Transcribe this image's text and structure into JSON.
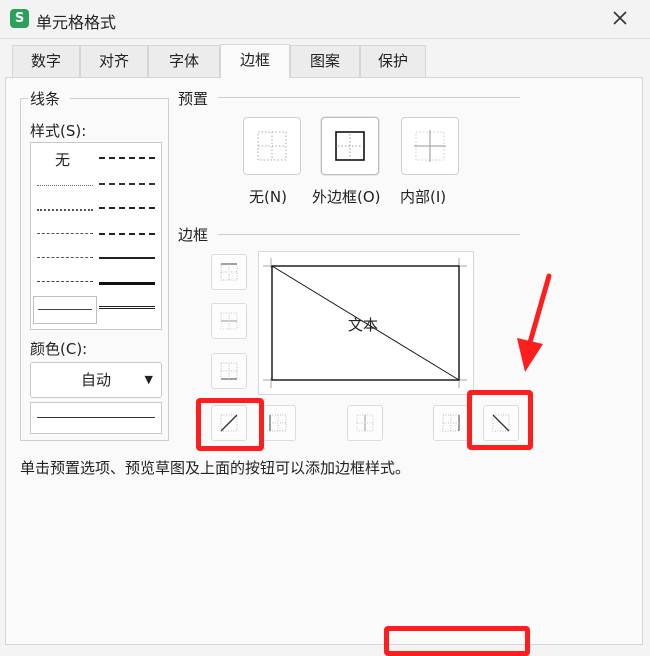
{
  "window": {
    "title": "单元格格式",
    "app_icon_letter": "S"
  },
  "tabs": [
    {
      "label": "数字"
    },
    {
      "label": "对齐"
    },
    {
      "label": "字体"
    },
    {
      "label": "边框"
    },
    {
      "label": "图案"
    },
    {
      "label": "保护"
    }
  ],
  "line": {
    "group_label": "线条",
    "style_label": "样式(S):",
    "none_label": "无",
    "color_label": "颜色(C):",
    "color_value": "自动"
  },
  "presets": {
    "group_label": "预置",
    "items": [
      {
        "label": "无(N)",
        "icon": "preset-none-icon"
      },
      {
        "label": "外边框(O)",
        "icon": "preset-outline-icon"
      },
      {
        "label": "内部(I)",
        "icon": "preset-inside-icon"
      }
    ]
  },
  "border": {
    "group_label": "边框",
    "preview_text": "文本"
  },
  "hint": "单击预置选项、预览草图及上面的按钮可以添加边框样式。",
  "colors": {
    "annotation": "#ff1e1e",
    "accent": "#2aa15a"
  }
}
